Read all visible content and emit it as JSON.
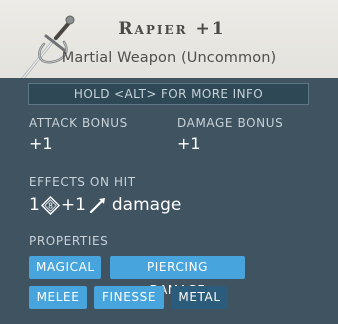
{
  "item": {
    "name": "Rapier +1",
    "type_line": "Martial Weapon (Uncommon)",
    "icon": "rapier-icon"
  },
  "hint": {
    "text": "HOLD <ALT> FOR MORE INFO"
  },
  "stats": {
    "attack_bonus_label": "ATTACK BONUS",
    "attack_bonus_value": "+1",
    "damage_bonus_label": "DAMAGE BONUS",
    "damage_bonus_value": "+1"
  },
  "effects": {
    "label": "EFFECTS ON HIT",
    "count": "1",
    "die_icon": "d8-die-icon",
    "die_number": "8",
    "bonus": "+1",
    "damage_type_icon": "piercing-icon",
    "damage_word": "damage"
  },
  "properties": {
    "label": "PROPERTIES",
    "tags": [
      {
        "label": "MAGICAL",
        "style": "highlighted"
      },
      {
        "label": "PIERCING DAMAGE",
        "style": "highlighted"
      },
      {
        "label": "MELEE",
        "style": "highlighted"
      },
      {
        "label": "FINESSE",
        "style": "highlighted"
      },
      {
        "label": "METAL",
        "style": "muted"
      }
    ]
  },
  "colors": {
    "header_bg": "#ecebe6",
    "panel_bg": "#3f5361",
    "tag_highlight": "#48a4dd",
    "tag_muted": "#2c5c7c"
  }
}
